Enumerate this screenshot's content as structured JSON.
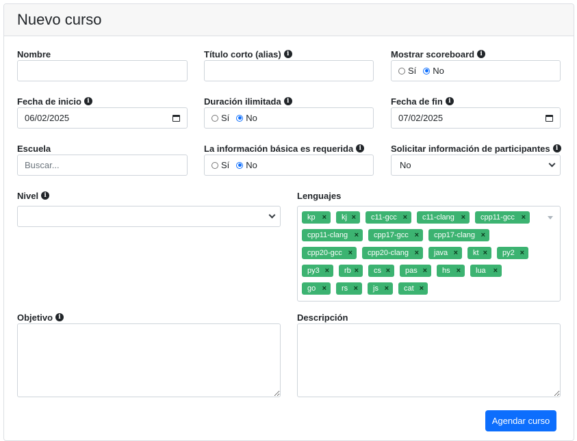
{
  "header": {
    "title": "Nuevo curso"
  },
  "fields": {
    "nombre": {
      "label": "Nombre",
      "value": ""
    },
    "alias": {
      "label": "Título corto (alias)",
      "value": ""
    },
    "scoreboard": {
      "label": "Mostrar scoreboard",
      "yes": "Sí",
      "no": "No",
      "selected": "No"
    },
    "start_date": {
      "label": "Fecha de inicio",
      "value": "06/02/2025"
    },
    "unlimited": {
      "label": "Duración ilimitada",
      "yes": "Sí",
      "no": "No",
      "selected": "No"
    },
    "end_date": {
      "label": "Fecha de fin",
      "value": "07/02/2025"
    },
    "school": {
      "label": "Escuela",
      "placeholder": "Buscar..."
    },
    "basic_info": {
      "label": "La información básica es requerida",
      "yes": "Sí",
      "no": "No",
      "selected": "No"
    },
    "participant_info": {
      "label": "Solicitar información de participantes",
      "value": "No"
    },
    "level": {
      "label": "Nivel",
      "value": ""
    },
    "languages": {
      "label": "Lenguajes",
      "tags": [
        "kp",
        "kj",
        "c11-gcc",
        "c11-clang",
        "cpp11-gcc",
        "cpp11-clang",
        "cpp17-gcc",
        "cpp17-clang",
        "cpp20-gcc",
        "cpp20-clang",
        "java",
        "kt",
        "py2",
        "py3",
        "rb",
        "cs",
        "pas",
        "hs",
        "lua",
        "go",
        "rs",
        "js",
        "cat"
      ],
      "remove_glyph": "×"
    },
    "objective": {
      "label": "Objetivo",
      "value": ""
    },
    "description": {
      "label": "Descripción",
      "value": ""
    }
  },
  "info_glyph": "i",
  "submit": {
    "label": "Agendar curso"
  },
  "colors": {
    "tag": "#3cb371",
    "primary": "#0d6efd",
    "header_bg": "#f7f7f7"
  }
}
